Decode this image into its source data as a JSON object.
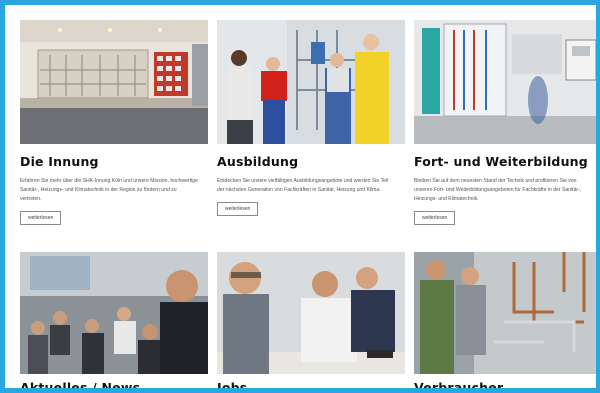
{
  "cards": [
    {
      "title": "Die Innung",
      "text": "Erfahren Sie mehr über die SHK-Innung Köln und unsere Mission, hochwertige Sanitär-, Heizungs- und Klimatechnik in der Region zu fördern und zu vertreten.",
      "button": "weiterlesen",
      "image": "training-workshop-room"
    },
    {
      "title": "Ausbildung",
      "text": "Entdecken Sie unsere vielfältigen Ausbildungsangebote und werden Sie Teil der nächsten Generation von Fachkräften in Sanitär, Heizung und Klima.",
      "button": "weiterlesen",
      "image": "apprentices-at-pipe-wall"
    },
    {
      "title": "Fort- und Weiterbildung",
      "text": "Bleiben Sie auf dem neuesten Stand der Technik und profitieren Sie von unseren Fort- und Weiterbildungsangeboten für Fachkräfte in der Sanitär-, Heizungs- und Klimatechnik.",
      "button": "weiterlesen",
      "image": "heating-lab"
    },
    {
      "title": "Aktuelles / News",
      "image": "group-seminar"
    },
    {
      "title": "Jobs",
      "image": "men-at-table"
    },
    {
      "title": "Verbraucher",
      "image": "technician-copper-pipes"
    }
  ],
  "colors": {
    "frame_border": "#2aa6e0",
    "title": "#111111",
    "body_text": "#555555"
  }
}
